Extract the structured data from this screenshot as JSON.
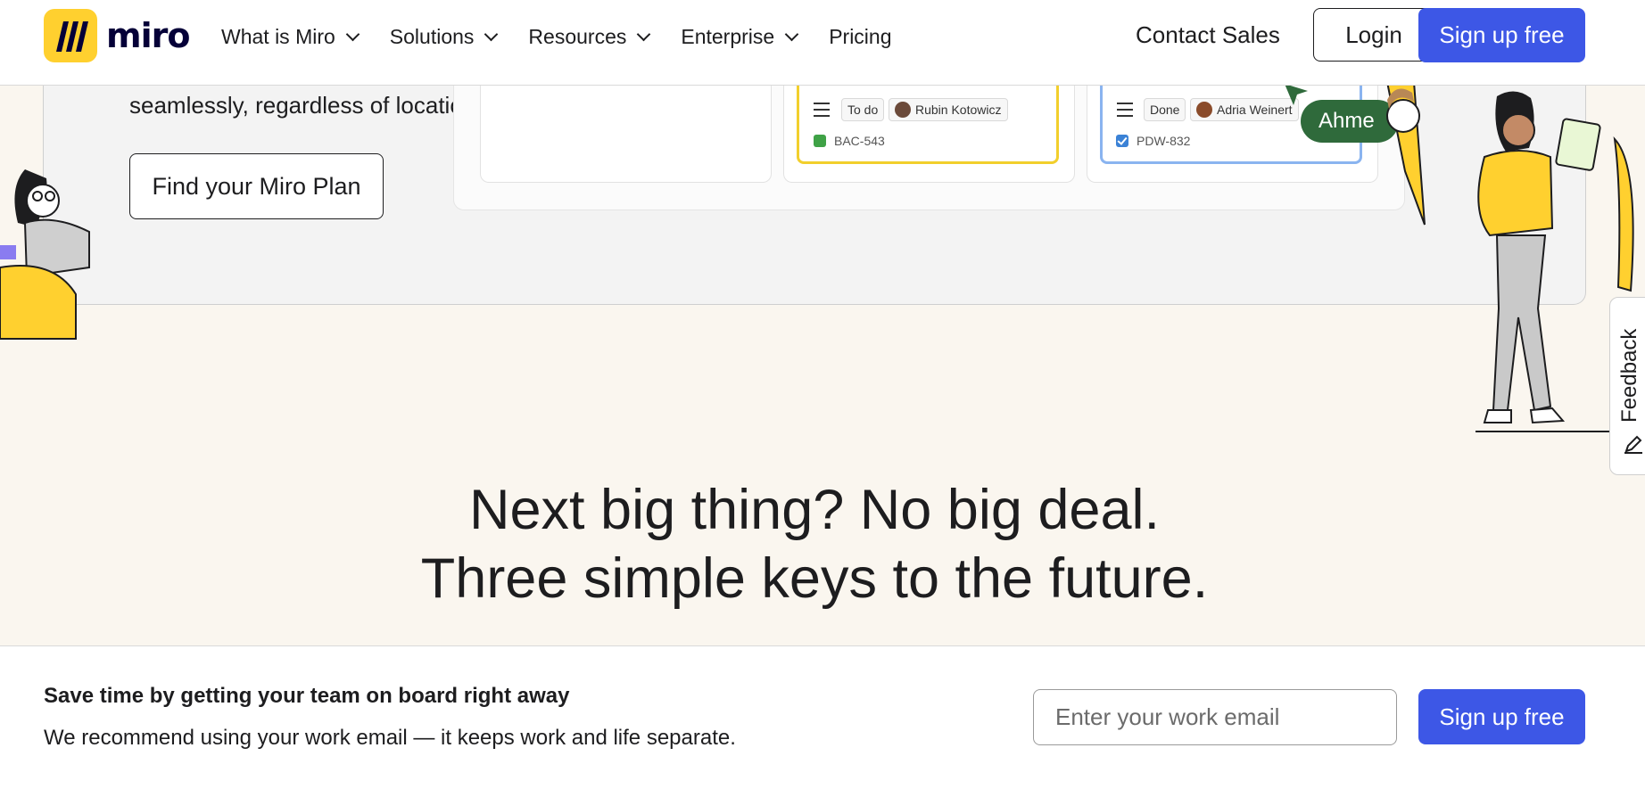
{
  "header": {
    "logo_text": "miro",
    "nav": [
      {
        "label": "What is Miro",
        "dropdown": true
      },
      {
        "label": "Solutions",
        "dropdown": true
      },
      {
        "label": "Resources",
        "dropdown": true
      },
      {
        "label": "Enterprise",
        "dropdown": true
      },
      {
        "label": "Pricing",
        "dropdown": false
      }
    ],
    "contact_label": "Contact Sales",
    "login_label": "Login",
    "signup_label": "Sign up free"
  },
  "hero": {
    "text": "seamlessly, regardless of location.",
    "find_plan_label": "Find your Miro Plan",
    "board": {
      "card1": {
        "status": "To do",
        "assignee": "Rubin Kotowicz",
        "ticket": "BAC-543"
      },
      "card2": {
        "status": "Done",
        "assignee": "Adria Weinert",
        "ticket": "PDW-832"
      },
      "cursor_label": "Ahme"
    }
  },
  "headline": {
    "line1": "Next big thing? No big deal.",
    "line2": "Three simple keys to the future."
  },
  "bottom_bar": {
    "title": "Save time by getting your team on board right away",
    "subtitle": "We recommend using your work email — it keeps work and life separate.",
    "email_placeholder": "Enter your work email",
    "signup_label": "Sign up free"
  },
  "feedback": {
    "label": "Feedback"
  },
  "colors": {
    "brand_yellow": "#ffd02f",
    "primary_blue": "#3d57e6",
    "cursor_green": "#2f6a3b",
    "page_bg": "#faf6ef"
  }
}
